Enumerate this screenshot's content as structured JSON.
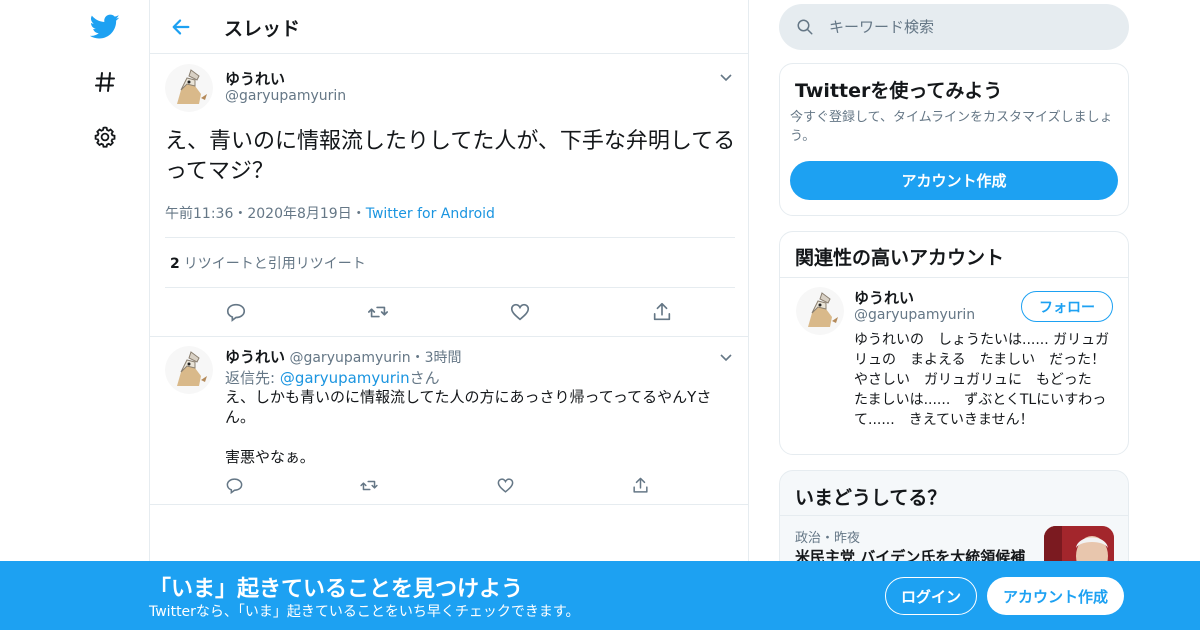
{
  "nav": {
    "icons": [
      "twitter-bird-icon",
      "hashtag-icon",
      "gear-icon"
    ]
  },
  "header": {
    "title": "スレッド",
    "back_icon": "arrow-left-icon"
  },
  "main_tweet": {
    "display_name": "ゆうれい",
    "handle": "@garyupamyurin",
    "text": "え、青いのに情報流したりしてた人が、下手な弁明してるってマジ？",
    "time": "午前11:36",
    "dot1": "・",
    "date": "2020年8月19日",
    "dot2": "・",
    "source": "Twitter for Android",
    "retweet_count": "2",
    "retweet_label": "リツイートと引用リツイート",
    "actions": [
      "reply-icon",
      "retweet-icon",
      "like-icon",
      "share-icon"
    ]
  },
  "reply_tweet": {
    "display_name": "ゆうれい",
    "handle": "@garyupamyurin",
    "dot": "・",
    "time": "3時間",
    "reply_prefix": "返信先: ",
    "reply_to": "@garyupamyurin",
    "reply_suffix": "さん",
    "text": "え、しかも青いのに情報流してた人の方にあっさり帰ってってるやんYさん。\n\n害悪やなぁ。",
    "actions": [
      "reply-icon",
      "retweet-icon",
      "like-icon",
      "share-icon"
    ]
  },
  "search": {
    "placeholder": "キーワード検索"
  },
  "try_card": {
    "title": "Twitterを使ってみよう",
    "subtitle": "今すぐ登録して、タイムラインをカスタマイズしましょう。",
    "button": "アカウント作成"
  },
  "related_card": {
    "title": "関連性の高いアカウント",
    "name": "ゆうれい",
    "handle": "@garyupamyurin",
    "follow": "フォロー",
    "bio": "ゆうれいの　しょうたいは...... ガリュガリュの　まよえる　たましい　だった！ やさしい　ガリュガリュに　もどった　たましいは......　ずぶとくTLにいすわって......　きえていきません！"
  },
  "trends_card": {
    "title": "いまどうしてる？",
    "meta_category": "政治",
    "meta_dot": "・",
    "meta_time": "昨夜",
    "headline": "米民主党 バイデン氏を大統領候補"
  },
  "bottom_bar": {
    "title": "「いま」起きていることを見つけよう",
    "subtitle": "Twitterなら、「いま」起きていることをいち早くチェックできます。",
    "login": "ログイン",
    "signup": "アカウント作成"
  },
  "colors": {
    "accent": "#1da1f2",
    "link": "#1b95e0",
    "secondary_text": "#657786",
    "border": "#e6ecf0"
  }
}
